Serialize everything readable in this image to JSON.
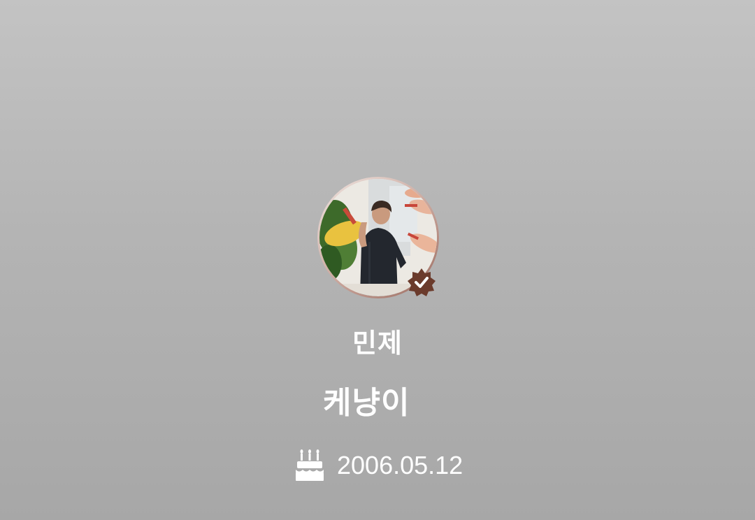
{
  "profile": {
    "name": "민제",
    "nickname": "케냥이",
    "birthday": "2006.05.12",
    "verified": true
  },
  "icons": {
    "avatar": "profile-photo",
    "verified": "verified-badge-icon",
    "birthday": "birthday-cake-icon"
  },
  "colors": {
    "background_top": "#c3c3c3",
    "background_bottom": "#a7a7a7",
    "verified_badge": "#6b3b2c",
    "text": "#ffffff"
  }
}
